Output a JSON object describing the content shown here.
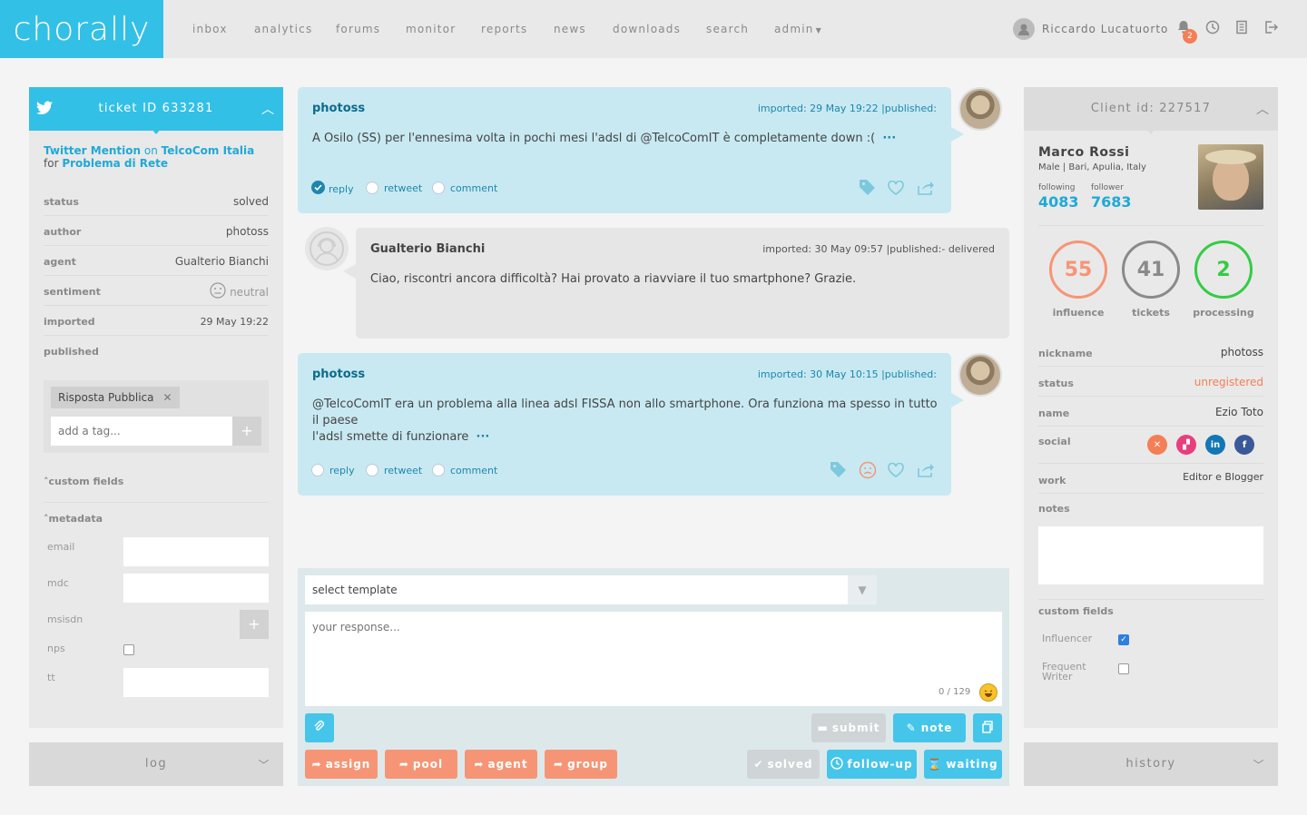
{
  "brand": {
    "logo_text": "chorally"
  },
  "nav": [
    "inbox",
    "analytics",
    "forums",
    "monitor",
    "reports",
    "news",
    "downloads",
    "search",
    "admin"
  ],
  "user": {
    "name": "Riccardo Lucatuorto",
    "notifications": "2"
  },
  "ticket": {
    "header": "ticket ID 633281",
    "source_type": "Twitter Mention",
    "on_word": "on",
    "brand": "TelcoCom Italia",
    "for_word": "for",
    "topic": "Problema di Rete",
    "fields": [
      {
        "k": "status",
        "v": "solved"
      },
      {
        "k": "author",
        "v": "photoss"
      },
      {
        "k": "agent",
        "v": "Gualterio Bianchi"
      },
      {
        "k": "sentiment",
        "v": "neutral"
      },
      {
        "k": "imported",
        "v": "29 May 19:22"
      },
      {
        "k": "published",
        "v": ""
      }
    ],
    "tag": "Risposta Pubblica",
    "tag_placeholder": "add a tag...",
    "custom_fields_label": "custom fields",
    "metadata_label": "metadata",
    "metadata": [
      "email",
      "mdc",
      "msisdn",
      "nps",
      "tt"
    ]
  },
  "messages": [
    {
      "author": "photoss",
      "meta": "imported: 29 May 19:22 |published:",
      "text": "A Osilo (SS) per l'ennesima volta in pochi mesi l'adsl di @TelcoComIT è completamente down :(",
      "actions": [
        "reply",
        "retweet",
        "comment"
      ]
    },
    {
      "author": "Gualterio Bianchi",
      "meta": "imported: 30 May 09:57 |published:- delivered",
      "text": "Ciao, riscontri ancora difficoltà? Hai provato a riavviare il tuo smartphone? Grazie."
    },
    {
      "author": "photoss",
      "meta": "imported: 30 May 10:15 |published:",
      "text_line1": "@TelcoComIT era un problema alla linea adsl FISSA non allo smartphone. Ora funziona ma spesso in tutto il paese",
      "text_line2": "l'adsl smette di funzionare",
      "actions": [
        "reply",
        "retweet",
        "comment"
      ]
    }
  ],
  "response": {
    "template_placeholder": "select template",
    "response_placeholder": "your response...",
    "counter": "0 / 129",
    "buttons": {
      "submit": "submit",
      "note": "note",
      "assign": "assign",
      "pool": "pool",
      "agent": "agent",
      "group": "group",
      "solved": "solved",
      "followup": "follow-up",
      "waiting": "waiting"
    }
  },
  "client": {
    "header": "Client id: 227517",
    "name": "Marco Rossi",
    "info": "Male | Bari, Apulia, Italy",
    "following_label": "following",
    "following": "4083",
    "follower_label": "follower",
    "follower": "7683",
    "stats": [
      {
        "value": "55",
        "label": "influence",
        "color": "#f69575"
      },
      {
        "value": "41",
        "label": "tickets",
        "color": "#8a8a8a"
      },
      {
        "value": "2",
        "label": "processing",
        "color": "#33cc44"
      }
    ],
    "fields": [
      {
        "k": "nickname",
        "v": "photoss"
      },
      {
        "k": "status",
        "v": "unregistered"
      },
      {
        "k": "name",
        "v": "Ezio Toto"
      },
      {
        "k": "social",
        "v": ""
      },
      {
        "k": "work",
        "v": "Editor e Blogger"
      },
      {
        "k": "notes",
        "v": ""
      }
    ],
    "custom_fields_label": "custom fields",
    "custom": [
      {
        "label": "Influencer",
        "checked": true
      },
      {
        "label": "Frequent Writer",
        "checked": false
      }
    ]
  },
  "bottom": {
    "log": "log",
    "history": "history"
  },
  "colors": {
    "accent": "#33c0e6",
    "orange": "#f69575",
    "green": "#33cc44"
  }
}
